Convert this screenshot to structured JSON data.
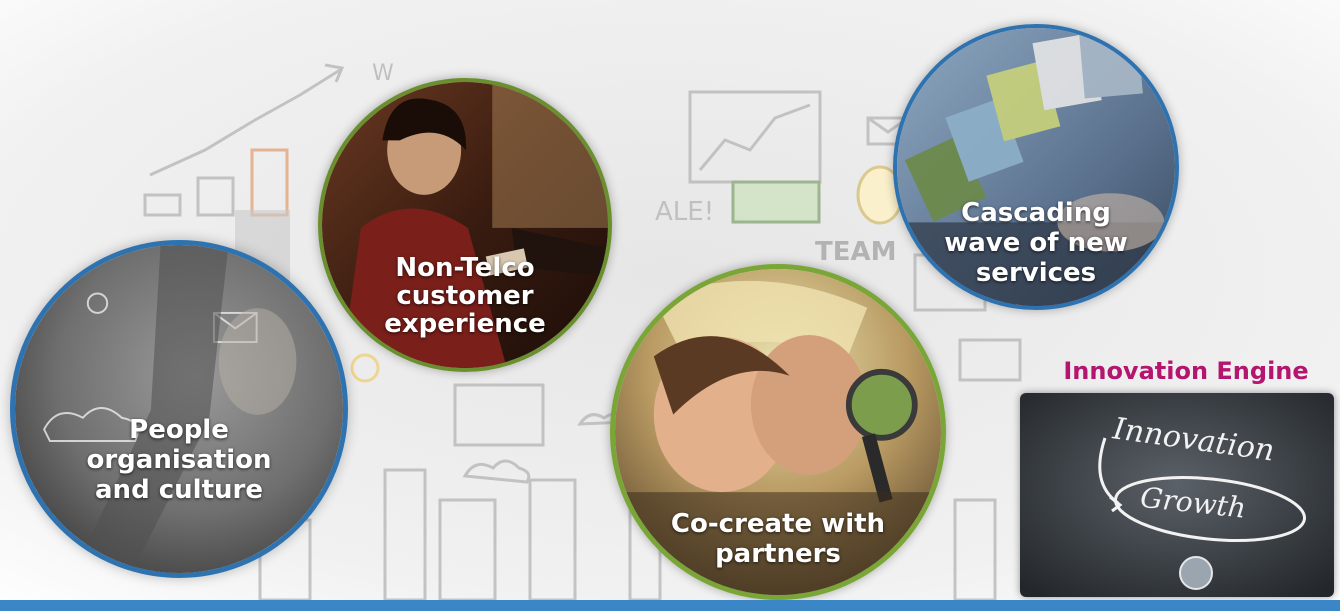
{
  "circles": {
    "people": "People organisation and culture",
    "people_lines": [
      "People",
      "organisation",
      "and culture"
    ],
    "nontelco_lines": [
      "Non-Telco",
      "customer",
      "experience"
    ],
    "cocreate_lines": [
      "Co-create with",
      "partners"
    ],
    "cascade_lines": [
      "Cascading",
      "wave of new",
      "services"
    ]
  },
  "engine": {
    "title": "Innovation Engine",
    "chalk_word_1": "Innovation",
    "chalk_word_2": "Growth"
  },
  "background": {
    "sign_text": "TEAM",
    "sketch_text_1": "ALE!",
    "sketch_text_2": "W"
  },
  "colors": {
    "accent_blue": "#3a86c6",
    "title_magenta": "#b4156f",
    "ring_blue": "#2f72b0",
    "ring_green": "#7aa537"
  }
}
